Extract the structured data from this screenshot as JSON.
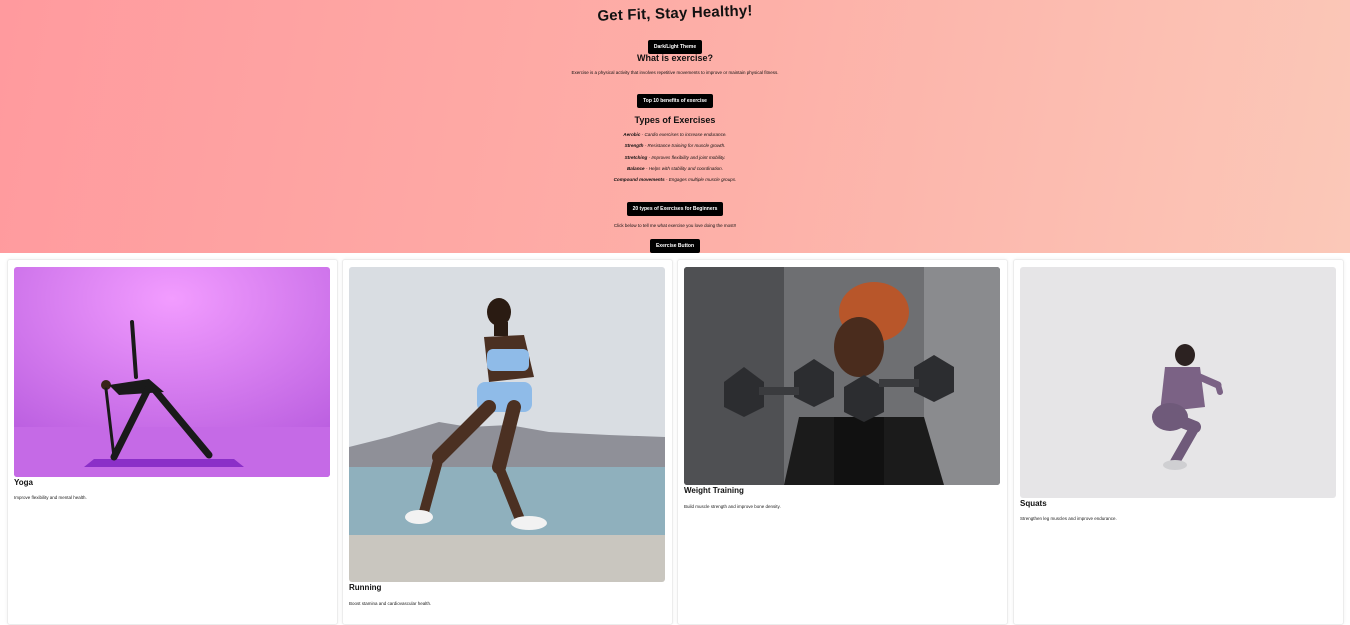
{
  "hero": {
    "title": "Get Fit, Stay Healthy!",
    "theme_button": "Dark/Light Theme",
    "what_heading": "What is exercise?",
    "what_text": "Exercise is a physical activity that involves repetitive movements to improve or maintain physical fitness.",
    "benefits_button": "Top 10 benefits of exercise",
    "types_heading": "Types of Exercises",
    "types": [
      {
        "name": "Aerobic",
        "desc": " - Cardio exercises to increase endurance."
      },
      {
        "name": "Strength",
        "desc": " - Resistance training for muscle growth."
      },
      {
        "name": "Stretching",
        "desc": " - Improves flexibility and joint mobility."
      },
      {
        "name": "Balance",
        "desc": " - Helps with stability and coordination."
      },
      {
        "name": "Compound movements",
        "desc": " - Engages multiple muscle groups."
      }
    ],
    "beginners_button": "20 types of Exercises for Beginners",
    "click_text": "Click below to tell me what exercise you love doing the most!!",
    "exercise_button": "Exercise Button",
    "gradient": [
      "#ff9a9e",
      "#fbc8b8"
    ]
  },
  "cards": [
    {
      "title": "Yoga",
      "desc": "Improve flexibility and mental health.",
      "image": "yoga-photo"
    },
    {
      "title": "Running",
      "desc": "Boost stamina and cardiovascular health.",
      "image": "running-photo"
    },
    {
      "title": "Weight Training",
      "desc": "Build muscle strength and improve bone density.",
      "image": "weight-training-photo"
    },
    {
      "title": "Squats",
      "desc": "Strengthen leg muscles and improve endurance.",
      "image": "squats-photo"
    }
  ]
}
